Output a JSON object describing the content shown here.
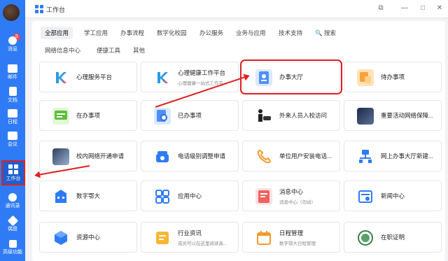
{
  "sidebar": {
    "badge_count": "5",
    "items": [
      {
        "label": "消息"
      },
      {
        "label": "邮件"
      },
      {
        "label": "文档"
      },
      {
        "label": "日程"
      },
      {
        "label": "会议"
      },
      {
        "label": "工作台"
      },
      {
        "label": "通讯录"
      },
      {
        "label": "偶盘"
      },
      {
        "label": "高级功能"
      }
    ]
  },
  "topbar": {
    "title": "工作台",
    "btn_pin": "⧉",
    "btn_min": "—",
    "btn_max": "□",
    "btn_close": "✕"
  },
  "tabs": [
    {
      "label": "全部应用"
    },
    {
      "label": "学工应用"
    },
    {
      "label": "办事流程"
    },
    {
      "label": "数字化校园"
    },
    {
      "label": "办公服务"
    },
    {
      "label": "业务与应用"
    },
    {
      "label": "技术支持"
    },
    {
      "label": "🔍 搜索"
    },
    {
      "label": "网络信息中心"
    },
    {
      "label": "便捷工具"
    },
    {
      "label": "其他"
    }
  ],
  "cards": [
    {
      "title": "心理服务平台",
      "sub": ""
    },
    {
      "title": "心理健康工作平台",
      "sub": "心理健康一站式工作平..."
    },
    {
      "title": "办事大厅",
      "sub": ""
    },
    {
      "title": "待办事项",
      "sub": ""
    },
    {
      "title": "在办事项",
      "sub": ""
    },
    {
      "title": "已办事项",
      "sub": ""
    },
    {
      "title": "外来人员入校访问",
      "sub": ""
    },
    {
      "title": "重要活动网络保障...",
      "sub": ""
    },
    {
      "title": "校内网络开通申请",
      "sub": ""
    },
    {
      "title": "电话级别调整申请",
      "sub": ""
    },
    {
      "title": "单位用户安装电话...",
      "sub": ""
    },
    {
      "title": "网上办事大厅新建...",
      "sub": ""
    },
    {
      "title": "数字鄂大",
      "sub": ""
    },
    {
      "title": "应用中心",
      "sub": ""
    },
    {
      "title": "消息中心",
      "sub": "消息中心（勿动）"
    },
    {
      "title": "新闻中心",
      "sub": ""
    },
    {
      "title": "资源中心",
      "sub": ""
    },
    {
      "title": "行业资讯",
      "sub": "成员可以在这里阅读高..."
    },
    {
      "title": "日程管理",
      "sub": "数字鄂大日程管理"
    },
    {
      "title": "在职证明",
      "sub": ""
    }
  ],
  "colors": {
    "accent": "#2f7bf5",
    "highlight": "#e02020"
  }
}
